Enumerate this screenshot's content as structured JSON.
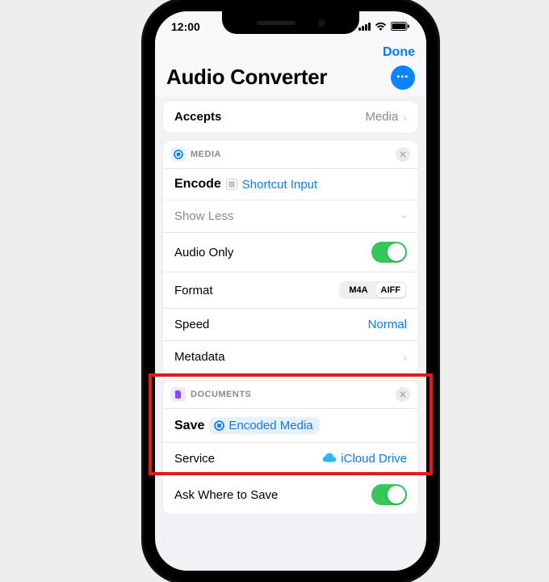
{
  "status": {
    "time": "12:00"
  },
  "header": {
    "done": "Done",
    "title": "Audio Converter"
  },
  "accepts": {
    "label": "Accepts",
    "value": "Media"
  },
  "mediaCard": {
    "caption": "MEDIA",
    "actionVerb": "Encode",
    "pill": "Shortcut Input",
    "showLess": "Show Less",
    "audioOnly": {
      "label": "Audio Only"
    },
    "format": {
      "label": "Format",
      "options": [
        "M4A",
        "AIFF"
      ],
      "selected": "AIFF"
    },
    "speed": {
      "label": "Speed",
      "value": "Normal"
    },
    "metadata": {
      "label": "Metadata"
    }
  },
  "docsCard": {
    "caption": "DOCUMENTS",
    "actionVerb": "Save",
    "pill": "Encoded Media",
    "service": {
      "label": "Service",
      "value": "iCloud Drive"
    },
    "ask": {
      "label": "Ask Where to Save"
    }
  }
}
